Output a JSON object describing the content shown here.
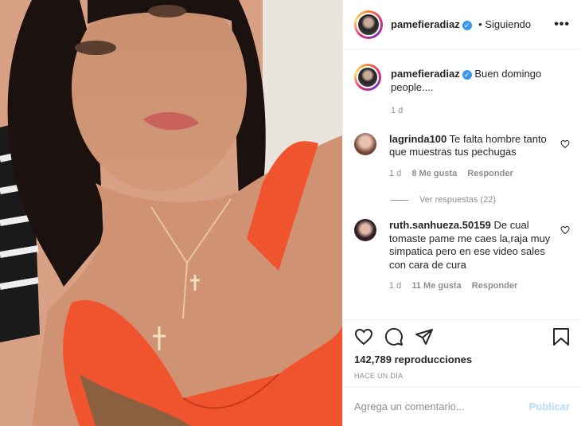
{
  "post": {
    "username": "pamefieradiaz",
    "verified_mark": "✓",
    "follow_status": "• Siguiendo",
    "more_icon": "more-dots-icon",
    "caption": "Buen domingo people....",
    "caption_time": "1 d"
  },
  "comments": [
    {
      "username": "lagrinda100",
      "text": "Te falta hombre tanto que muestras tus pechugas",
      "time": "1 d",
      "likes": "8 Me gusta",
      "reply": "Responder",
      "view_replies": "Ver respuestas (22)"
    },
    {
      "username": "ruth.sanhueza.50159",
      "text": "De cual tomaste pame me caes la,raja muy simpatica pero en ese video sales con cara de cura",
      "time": "1 d",
      "likes": "11 Me gusta",
      "reply": "Responder"
    }
  ],
  "actions": {
    "views": "142,789 reproducciones",
    "posted": "HACE UN DÍA",
    "icons": [
      "heart-icon",
      "comment-icon",
      "share-icon",
      "bookmark-icon"
    ]
  },
  "composer": {
    "placeholder": "Agrega un comentario...",
    "publish_label": "Publicar"
  },
  "colors": {
    "link_blue": "#3897f0",
    "publish_disabled": "#b3dbff",
    "muted_text": "#8e8e8e",
    "swimsuit": "#f0542e"
  }
}
